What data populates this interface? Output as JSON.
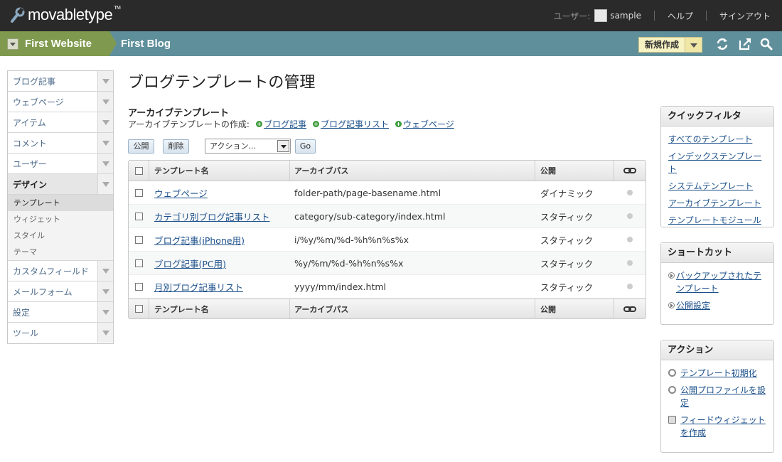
{
  "header": {
    "logo_text": "movabletype",
    "logo_tm": "TM",
    "user_label": "ユーザー:",
    "username": "sample",
    "help": "ヘルプ",
    "signout": "サインアウト"
  },
  "scope": {
    "website": "First Website",
    "blog": "First Blog",
    "new_button": "新規作成"
  },
  "nav": {
    "items": [
      {
        "label": "ブログ記事"
      },
      {
        "label": "ウェブページ"
      },
      {
        "label": "アイテム"
      },
      {
        "label": "コメント"
      },
      {
        "label": "ユーザー"
      },
      {
        "label": "デザイン"
      },
      {
        "label": "カスタムフィールド"
      },
      {
        "label": "メールフォーム"
      },
      {
        "label": "設定"
      },
      {
        "label": "ツール"
      }
    ],
    "design_sub": [
      "テンプレート",
      "ウィジェット",
      "スタイル",
      "テーマ"
    ]
  },
  "main": {
    "title": "ブログテンプレートの管理",
    "section": "アーカイブテンプレート",
    "create_label": "アーカイブテンプレートの作成:",
    "create_links": [
      "ブログ記事",
      "ブログ記事リスト",
      "ウェブページ"
    ],
    "publish_btn": "公開",
    "delete_btn": "削除",
    "action_select": "アクション...",
    "go_btn": "Go",
    "columns": [
      "テンプレート名",
      "アーカイブパス",
      "公開"
    ],
    "rows": [
      {
        "name": "ウェブページ",
        "path": "folder-path/page-basename.html",
        "publish": "ダイナミック"
      },
      {
        "name": "カテゴリ別ブログ記事リスト",
        "path": "category/sub-category/index.html",
        "publish": "スタティック"
      },
      {
        "name": "ブログ記事(iPhone用)",
        "path": "i/%y/%m/%d-%h%n%s%x",
        "publish": "スタティック"
      },
      {
        "name": "ブログ記事(PC用)",
        "path": "%y/%m/%d-%h%n%s%x",
        "publish": "スタティック"
      },
      {
        "name": "月別ブログ記事リスト",
        "path": "yyyy/mm/index.html",
        "publish": "スタティック"
      }
    ]
  },
  "quickfilter": {
    "title": "クイックフィルタ",
    "links": [
      "すべてのテンプレート",
      "インデックステンプレート",
      "システムテンプレート",
      "アーカイブテンプレート",
      "テンプレートモジュール"
    ]
  },
  "shortcut": {
    "title": "ショートカット",
    "links": [
      "バックアップされたテンプレート",
      "公開設定"
    ]
  },
  "actions": {
    "title": "アクション",
    "links": [
      "テンプレート初期化",
      "公開プロファイルを設定",
      "フィードウィジェットを作成"
    ]
  }
}
